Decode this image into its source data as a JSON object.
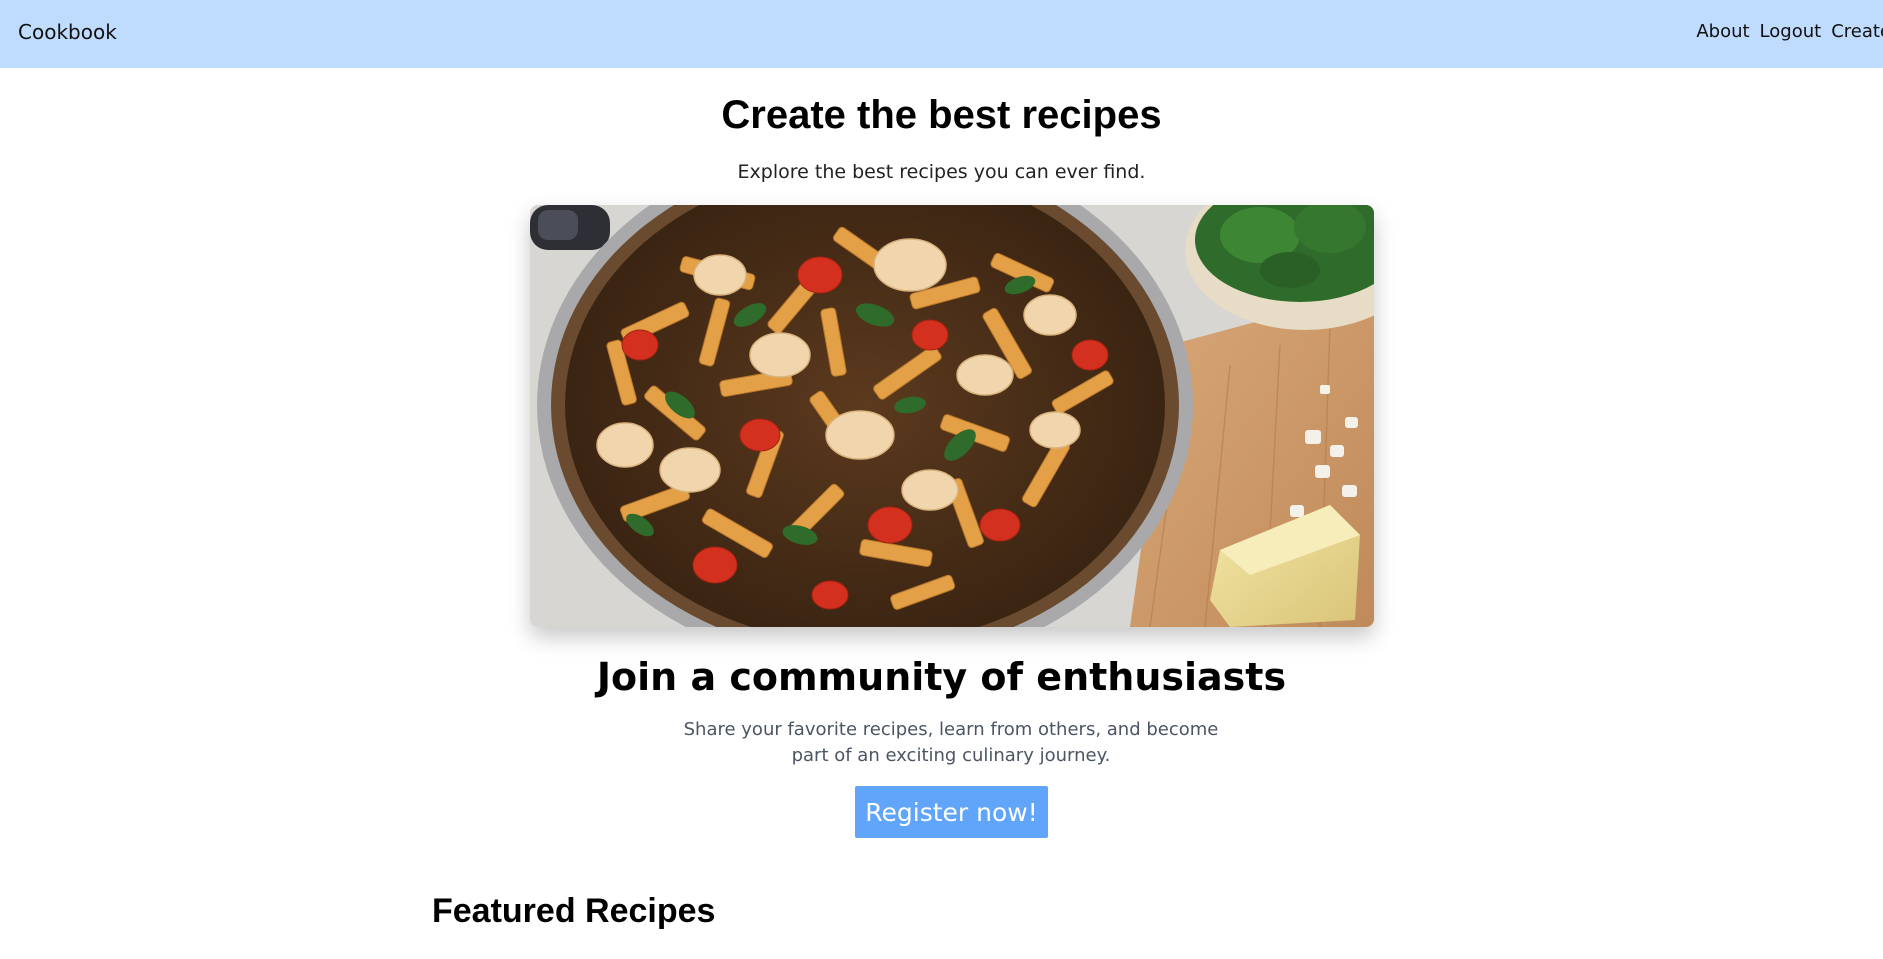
{
  "nav": {
    "brand": "Cookbook",
    "links": [
      {
        "label": "About"
      },
      {
        "label": "Logout"
      },
      {
        "label": "Create"
      }
    ]
  },
  "hero": {
    "title": "Create the best recipes",
    "subtitle": "Explore the best recipes you can ever find."
  },
  "community": {
    "title": "Join a community of enthusiasts",
    "description": "Share your favorite recipes, learn from others, and become part of an exciting culinary journey.",
    "button_label": "Register now!"
  },
  "featured": {
    "title": "Featured Recipes"
  },
  "colors": {
    "navbar_bg": "#bfdbfe",
    "button_bg": "#60a5fa"
  }
}
